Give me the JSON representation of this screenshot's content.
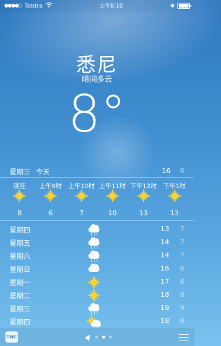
{
  "status": {
    "carrier": "Telstra",
    "signal": "●●●●○",
    "time": "上午8:10",
    "bluetooth": "✱"
  },
  "location": {
    "city": "悉尼",
    "condition": "晴间多云",
    "temperature": "8°"
  },
  "today": {
    "day": "星期三",
    "label": "今天",
    "high": "16",
    "low": "6"
  },
  "hourly": [
    {
      "time": "现在",
      "icon": "sun",
      "temp": "8"
    },
    {
      "time": "上午9时",
      "icon": "sun",
      "temp": "6"
    },
    {
      "time": "上午10时",
      "icon": "sun",
      "temp": "7"
    },
    {
      "time": "上午11时",
      "icon": "sun",
      "temp": "10"
    },
    {
      "time": "下午12时",
      "icon": "sun",
      "temp": "13"
    },
    {
      "time": "下午1时",
      "icon": "sun",
      "temp": "13"
    }
  ],
  "daily": [
    {
      "day": "星期四",
      "icon": "rain",
      "high": "13",
      "low": "7"
    },
    {
      "day": "星期五",
      "icon": "rain",
      "high": "14",
      "low": "7"
    },
    {
      "day": "星期六",
      "icon": "rain",
      "high": "14",
      "low": "7"
    },
    {
      "day": "星期日",
      "icon": "cloud",
      "high": "16",
      "low": "6"
    },
    {
      "day": "星期一",
      "icon": "sun",
      "high": "17",
      "low": "6"
    },
    {
      "day": "星期二",
      "icon": "sun",
      "high": "18",
      "low": "8"
    },
    {
      "day": "星期三",
      "icon": "rain",
      "high": "19",
      "low": "9"
    },
    {
      "day": "星期四",
      "icon": "sun-cloud",
      "high": "18",
      "low": "8"
    }
  ],
  "bottom": {
    "logo": "The Weather Channel",
    "page_count": 3,
    "active_page": 2
  }
}
